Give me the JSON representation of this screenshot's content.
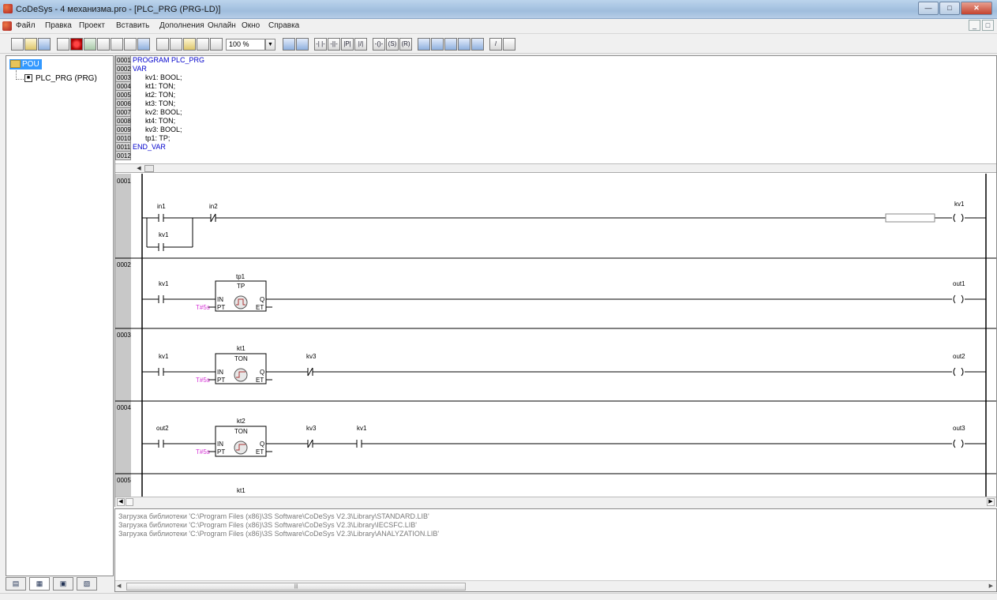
{
  "window": {
    "title": "CoDeSys - 4 механизма.pro - [PLC_PRG (PRG-LD)]"
  },
  "menu": {
    "items": [
      "Файл",
      "Правка",
      "Проект",
      "Вставить",
      "Дополнения",
      "Онлайн",
      "Окно",
      "Справка"
    ]
  },
  "toolbar": {
    "zoom": "100 %"
  },
  "tree": {
    "root": "POU",
    "child": "PLC_PRG (PRG)"
  },
  "declarations": [
    {
      "num": "0001",
      "text": "PROGRAM PLC_PRG",
      "kw": true
    },
    {
      "num": "0002",
      "text": "VAR",
      "kw": true
    },
    {
      "num": "0003",
      "text": "kv1: BOOL;",
      "kw": false
    },
    {
      "num": "0004",
      "text": "kt1: TON;",
      "kw": false
    },
    {
      "num": "0005",
      "text": "kt2: TON;",
      "kw": false
    },
    {
      "num": "0006",
      "text": "kt3: TON;",
      "kw": false
    },
    {
      "num": "0007",
      "text": "kv2: BOOL;",
      "kw": false
    },
    {
      "num": "0008",
      "text": "kt4: TON;",
      "kw": false
    },
    {
      "num": "0009",
      "text": "kv3: BOOL;",
      "kw": false
    },
    {
      "num": "0010",
      "text": "tp1: TP;",
      "kw": false
    },
    {
      "num": "0011",
      "text": "END_VAR",
      "kw": true
    },
    {
      "num": "0012",
      "text": "",
      "kw": false
    }
  ],
  "networks": {
    "n1": {
      "num": "0001",
      "c1": "in1",
      "c2": "in2",
      "c3": "kv1",
      "coil": "kv1"
    },
    "n2": {
      "num": "0002",
      "contact": "kv1",
      "inst": "tp1",
      "type": "TP",
      "in": "IN",
      "pt_lbl": "PT",
      "q": "Q",
      "et": "ET",
      "pt": "T#5s",
      "coil": "out1"
    },
    "n3": {
      "num": "0003",
      "contact": "kv1",
      "inst": "kt1",
      "type": "TON",
      "in": "IN",
      "pt_lbl": "PT",
      "q": "Q",
      "et": "ET",
      "pt": "T#5s",
      "nc": "kv3",
      "coil": "out2"
    },
    "n4": {
      "num": "0004",
      "contact": "out2",
      "inst": "kt2",
      "type": "TON",
      "in": "IN",
      "pt_lbl": "PT",
      "q": "Q",
      "et": "ET",
      "pt": "T#5s",
      "nc": "kv3",
      "no": "kv1",
      "coil": "out3"
    },
    "n5": {
      "num": "0005",
      "inst": "kt1"
    }
  },
  "messages": [
    "Загрузка библиотеки 'C:\\Program Files (x86)\\3S Software\\CoDeSys V2.3\\Library\\STANDARD.LIB'",
    "Загрузка библиотеки 'C:\\Program Files (x86)\\3S Software\\CoDeSys V2.3\\Library\\IECSFC.LIB'",
    "Загрузка библиотеки 'C:\\Program Files (x86)\\3S Software\\CoDeSys V2.3\\Library\\ANALYZATION.LIB'"
  ]
}
